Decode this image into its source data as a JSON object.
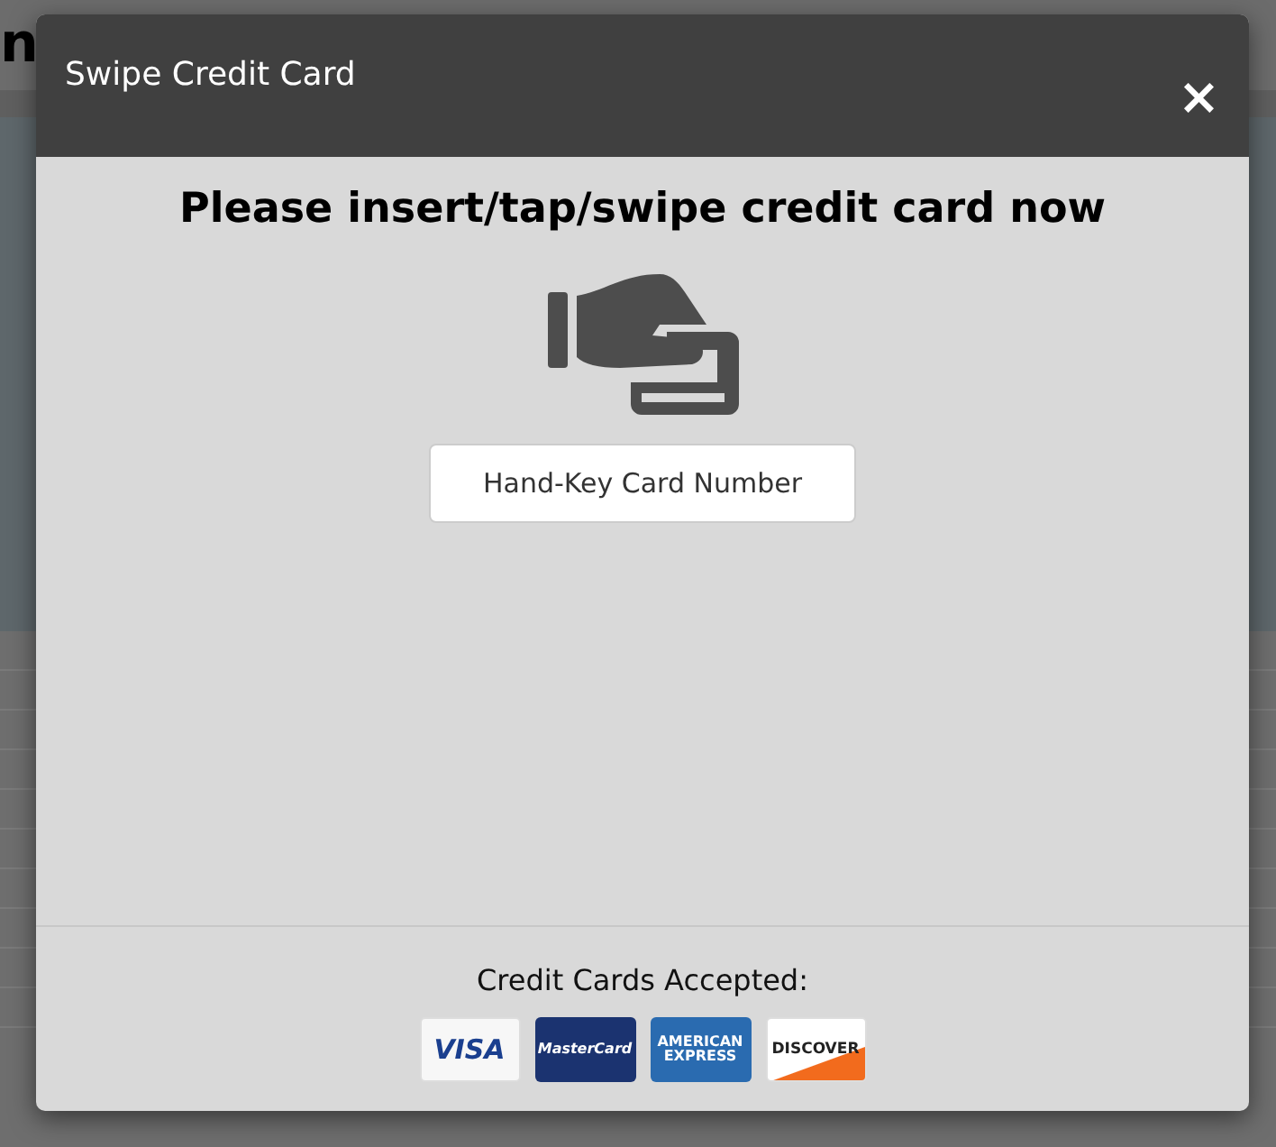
{
  "background_page": {
    "heading": "n"
  },
  "modal": {
    "title": "Swipe Credit Card",
    "close": "×",
    "prompt": "Please insert/tap/swipe credit card now",
    "button": "Hand-Key Card Number",
    "footer_label": "Credit Cards Accepted:",
    "cards": [
      {
        "kind": "visa",
        "lines": [
          "VISA"
        ]
      },
      {
        "kind": "mastercard",
        "lines": [
          "MasterCard"
        ]
      },
      {
        "kind": "amex",
        "lines": [
          "AMERICAN",
          "EXPRESS"
        ]
      },
      {
        "kind": "discover",
        "lines": [
          "DISCOVER"
        ]
      }
    ]
  }
}
